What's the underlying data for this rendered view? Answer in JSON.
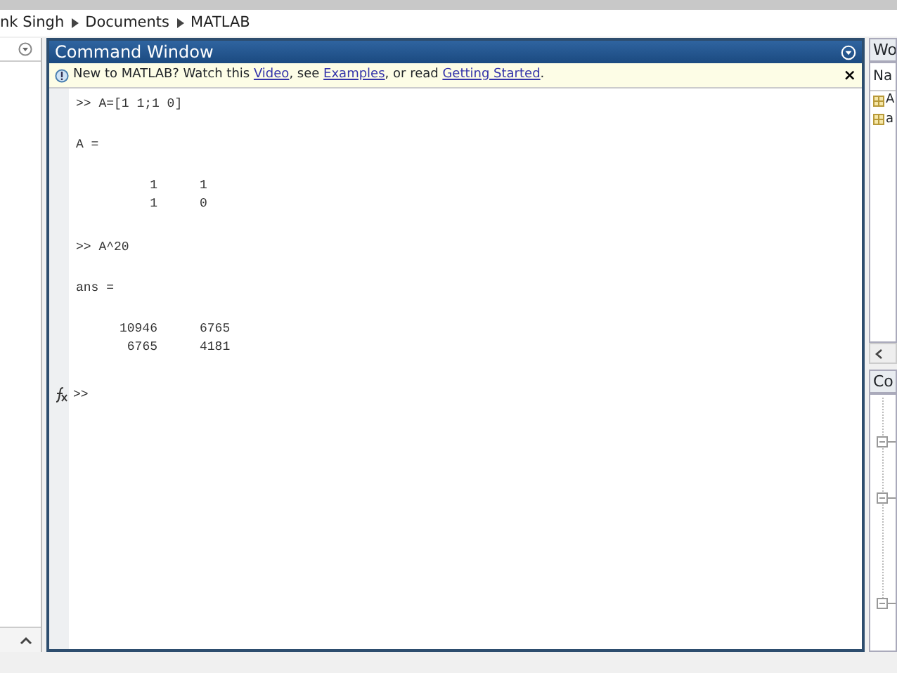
{
  "breadcrumb": [
    "nk Singh",
    "Documents",
    "MATLAB"
  ],
  "command_window": {
    "title": "Command Window",
    "notice": {
      "parts": [
        {
          "kind": "text",
          "text": "New to MATLAB? Watch this "
        },
        {
          "kind": "link",
          "text": "Video"
        },
        {
          "kind": "text",
          "text": ", see "
        },
        {
          "kind": "link",
          "text": "Examples"
        },
        {
          "kind": "text",
          "text": ", or read "
        },
        {
          "kind": "link",
          "text": "Getting Started"
        },
        {
          "kind": "text",
          "text": "."
        }
      ],
      "close": "×"
    },
    "blocks": [
      {
        "kind": "command",
        "text": ">> A=[1 1;1 0]"
      },
      {
        "kind": "label",
        "text": "A ="
      },
      {
        "kind": "matrix",
        "rows": [
          [
            "1",
            "1"
          ],
          [
            "1",
            "0"
          ]
        ]
      },
      {
        "kind": "command",
        "text": ">> A^20"
      },
      {
        "kind": "label",
        "text": "ans ="
      },
      {
        "kind": "matrix",
        "rows": [
          [
            "10946",
            "6765"
          ],
          [
            "6765",
            "4181"
          ]
        ]
      }
    ],
    "prompt": ">>"
  },
  "workspace": {
    "title": "Wo",
    "column": "Na",
    "items": [
      "A",
      "a"
    ]
  },
  "command_history": {
    "title": "Co"
  }
}
